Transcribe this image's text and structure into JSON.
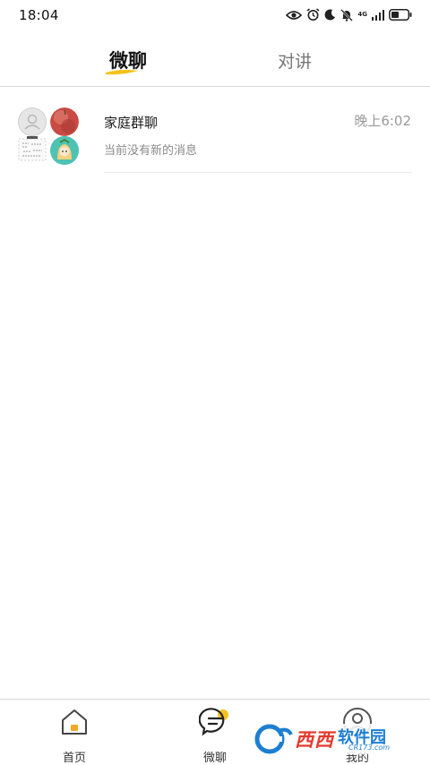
{
  "status_bar": {
    "time": "18:04",
    "network": "4G",
    "icons": [
      "eye-icon",
      "alarm-icon",
      "moon-icon",
      "mute-bell-icon",
      "signal-icon",
      "battery-icon"
    ]
  },
  "tabs": [
    {
      "label": "微聊",
      "active": true
    },
    {
      "label": "对讲",
      "active": false
    }
  ],
  "chats": [
    {
      "name": "家庭群聊",
      "preview": "当前没有新的消息",
      "time": "晚上6:02",
      "avatars": [
        "default-user-avatar",
        "apple-avatar",
        "qr-sketch-avatar",
        "cartoon-girl-avatar"
      ]
    }
  ],
  "bottom_nav": [
    {
      "label": "首页",
      "icon": "home-icon",
      "active": false
    },
    {
      "label": "微聊",
      "icon": "chat-bubble-icon",
      "active": true
    },
    {
      "label": "我的",
      "icon": "user-icon",
      "active": false
    }
  ],
  "watermark": {
    "brand": "西西",
    "brand2": "软件园",
    "url": "CR173.com"
  },
  "colors": {
    "accent": "#f5c21b",
    "text_primary": "#1a1a1a",
    "text_secondary": "#8a8a8a",
    "divider": "#d8d8d8"
  }
}
